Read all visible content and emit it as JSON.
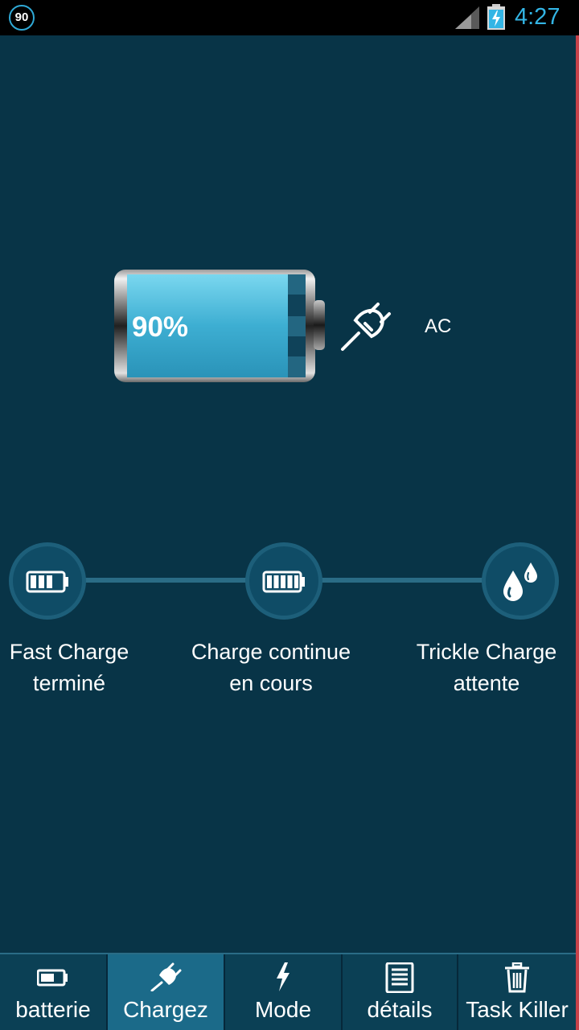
{
  "status_bar": {
    "badge": "90",
    "time": "4:27"
  },
  "battery": {
    "percent_label": "90%",
    "level": 0.9,
    "source": "AC"
  },
  "stages": [
    {
      "line1": "Fast Charge",
      "line2": "terminé",
      "icon": "battery-partial-icon"
    },
    {
      "line1": "Charge continue",
      "line2": "en cours",
      "icon": "battery-full-icon"
    },
    {
      "line1": "Trickle Charge",
      "line2": "attente",
      "icon": "droplets-icon"
    }
  ],
  "nav": [
    {
      "label": "batterie",
      "icon": "battery-icon",
      "active": false
    },
    {
      "label": "Chargez",
      "icon": "plug-icon",
      "active": true
    },
    {
      "label": "Mode",
      "icon": "lightning-icon",
      "active": false
    },
    {
      "label": "détails",
      "icon": "document-icon",
      "active": false
    },
    {
      "label": "Task Killer",
      "icon": "trash-icon",
      "active": false
    }
  ],
  "colors": {
    "background": "#083447",
    "accent": "#33b5e5",
    "battery_fill": "#5bc4e3",
    "active_tab": "#1b6a89"
  }
}
